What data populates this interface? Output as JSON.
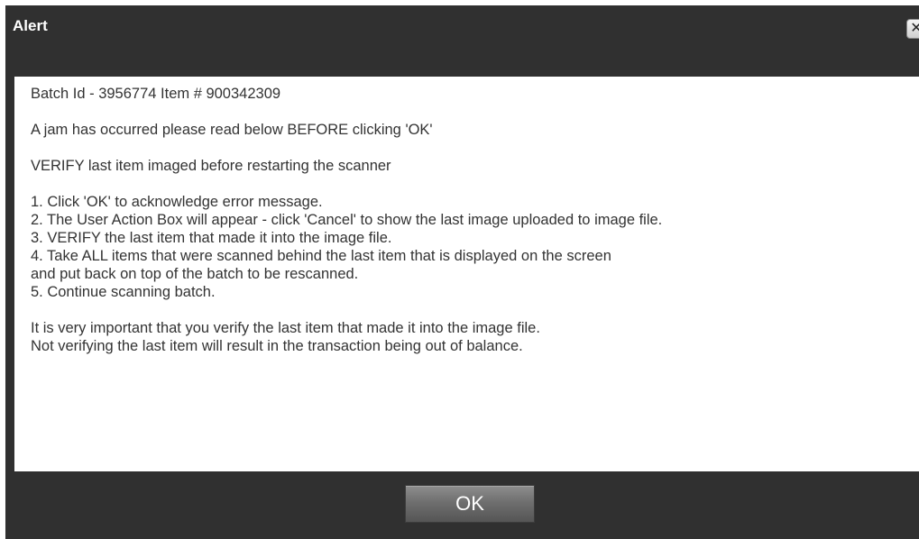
{
  "dialog": {
    "title": "Alert",
    "close_icon": "close-icon",
    "ok_label": "OK"
  },
  "message": {
    "batch_line": "Batch Id - 3956774 Item # 900342309",
    "jam_line": "A jam has occurred  please read below BEFORE clicking 'OK'",
    "verify_line": "VERIFY last item imaged before restarting the scanner",
    "steps": [
      "1. Click 'OK' to acknowledge error message.",
      "2. The User Action Box will appear - click 'Cancel' to show the last image uploaded to image file.",
      "3. VERIFY the last item that made it into the image file.",
      "4. Take ALL items that were scanned behind the last item that is displayed on the screen",
      "and put back on top of the batch to be rescanned.",
      "5. Continue scanning batch."
    ],
    "notes": [
      "It is very important that you verify the last item that made it into the image file.",
      "Not verifying the last item will result in the transaction being out of balance."
    ]
  },
  "colors": {
    "dialog_background": "#303030",
    "content_background": "#ffffff",
    "text": "#333333",
    "title_text": "#ffffff"
  }
}
